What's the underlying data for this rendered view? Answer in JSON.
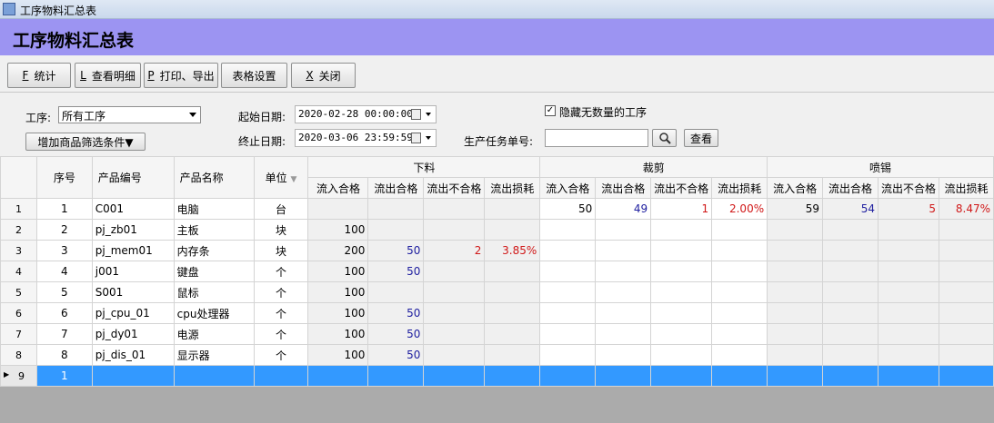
{
  "window": {
    "title": "工序物料汇总表"
  },
  "header": {
    "title": "工序物料汇总表"
  },
  "toolbar": {
    "stat": {
      "key": "F",
      "label": "统计"
    },
    "detail": {
      "key": "L",
      "label": "查看明细"
    },
    "print": {
      "key": "P",
      "label": "打印、导出"
    },
    "settings": {
      "label": "表格设置"
    },
    "close": {
      "key": "X",
      "label": "关闭"
    }
  },
  "filters": {
    "process_label": "工序:",
    "process_value": "所有工序",
    "add_filter_label": "增加商品筛选条件▼",
    "start_label": "起始日期:",
    "start_value": "2020-02-28 00:00:00",
    "end_label": "终止日期:",
    "end_value": "2020-03-06 23:59:59",
    "hide_label": "隐藏无数量的工序",
    "hide_checked": "✓",
    "task_label": "生产任务单号:",
    "task_value": "",
    "view_label": "查看"
  },
  "grid": {
    "headers": {
      "seq": "序号",
      "code": "产品编号",
      "name": "产品名称",
      "unit": "单位"
    },
    "groups": [
      "下料",
      "裁剪",
      "喷锡"
    ],
    "sub": [
      "流入合格",
      "流出合格",
      "流出不合格",
      "流出损耗"
    ],
    "rows": [
      {
        "rh": "1",
        "seq": "1",
        "code": "C001",
        "name": "电脑",
        "unit": "台",
        "v": [
          "",
          "",
          "",
          "",
          "50",
          "49",
          "1",
          "2.00%",
          "59",
          "54",
          "5",
          "8.47%"
        ]
      },
      {
        "rh": "2",
        "seq": "2",
        "code": "pj_zb01",
        "name": "主板",
        "unit": "块",
        "v": [
          "100",
          "",
          "",
          "",
          "",
          "",
          "",
          "",
          "",
          "",
          "",
          ""
        ]
      },
      {
        "rh": "3",
        "seq": "3",
        "code": "pj_mem01",
        "name": "内存条",
        "unit": "块",
        "v": [
          "200",
          "50",
          "2",
          "3.85%",
          "",
          "",
          "",
          "",
          "",
          "",
          "",
          ""
        ]
      },
      {
        "rh": "4",
        "seq": "4",
        "code": "j001",
        "name": "键盘",
        "unit": "个",
        "v": [
          "100",
          "50",
          "",
          "",
          "",
          "",
          "",
          "",
          "",
          "",
          "",
          ""
        ]
      },
      {
        "rh": "5",
        "seq": "5",
        "code": "S001",
        "name": "鼠标",
        "unit": "个",
        "v": [
          "100",
          "",
          "",
          "",
          "",
          "",
          "",
          "",
          "",
          "",
          "",
          ""
        ]
      },
      {
        "rh": "6",
        "seq": "6",
        "code": "pj_cpu_01",
        "name": "cpu处理器",
        "unit": "个",
        "v": [
          "100",
          "50",
          "",
          "",
          "",
          "",
          "",
          "",
          "",
          "",
          "",
          ""
        ]
      },
      {
        "rh": "7",
        "seq": "7",
        "code": "pj_dy01",
        "name": "电源",
        "unit": "个",
        "v": [
          "100",
          "50",
          "",
          "",
          "",
          "",
          "",
          "",
          "",
          "",
          "",
          ""
        ]
      },
      {
        "rh": "8",
        "seq": "8",
        "code": "pj_dis_01",
        "name": "显示器",
        "unit": "个",
        "v": [
          "100",
          "50",
          "",
          "",
          "",
          "",
          "",
          "",
          "",
          "",
          "",
          ""
        ]
      },
      {
        "rh": "9",
        "seq": "1",
        "code": "",
        "name": "",
        "unit": "",
        "v": [
          "",
          "",
          "",
          "",
          "",
          "",
          "",
          "",
          "",
          "",
          "",
          ""
        ],
        "selected": true
      }
    ]
  }
}
